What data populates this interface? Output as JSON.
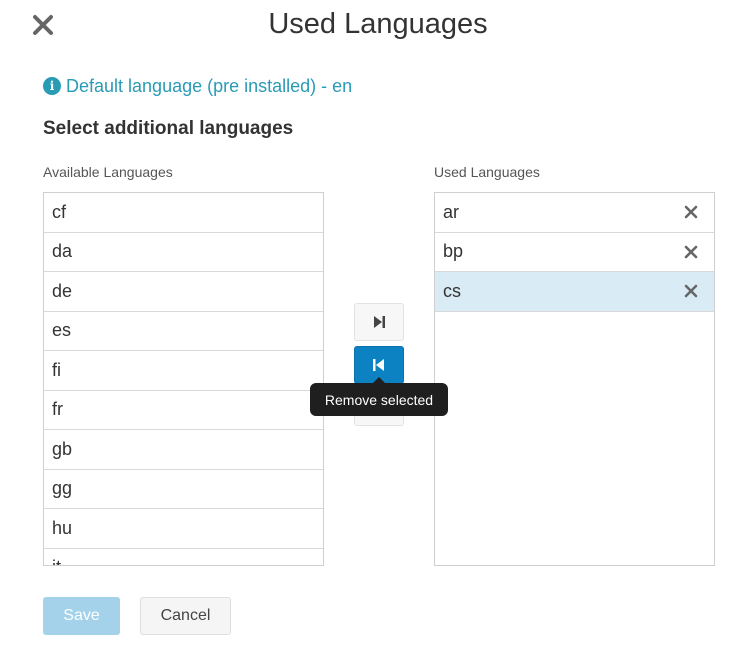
{
  "dialog": {
    "title": "Used Languages",
    "close_icon": "close-icon"
  },
  "info": {
    "icon": "info-icon",
    "icon_glyph": "i",
    "text": "Default language (pre installed) - en",
    "color": "#2a9bb5"
  },
  "section_heading": "Select additional languages",
  "available": {
    "label": "Available Languages",
    "items": [
      "cf",
      "da",
      "de",
      "es",
      "fi",
      "fr",
      "gb",
      "gg",
      "hu",
      "it"
    ]
  },
  "used": {
    "label": "Used Languages",
    "items": [
      {
        "code": "ar",
        "selected": false
      },
      {
        "code": "bp",
        "selected": false
      },
      {
        "code": "cs",
        "selected": true
      }
    ],
    "remove_icon": "close-icon",
    "selected_color": "#d9ebf5"
  },
  "transfer_buttons": [
    {
      "icon": "step-forward-icon",
      "state": "default"
    },
    {
      "icon": "step-backward-icon",
      "state": "active"
    },
    {
      "icon": "fast-backward-icon",
      "state": "default"
    }
  ],
  "tooltip": {
    "text": "Remove selected"
  },
  "footer": {
    "save_label": "Save",
    "cancel_label": "Cancel"
  },
  "colors": {
    "accent": "#0d82c3",
    "save_disabled": "#a3d2ea"
  }
}
